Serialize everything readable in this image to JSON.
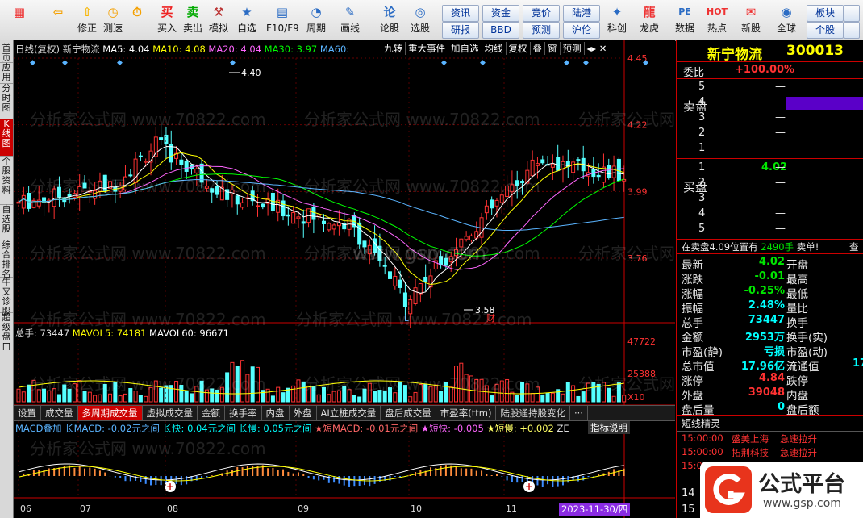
{
  "toolbar": {
    "buttons": [
      {
        "label": "",
        "icon": "grid-icon"
      },
      {
        "label": "",
        "icon": "back-arrow-icon"
      },
      {
        "label": "修正",
        "icon": "arrows-up-down-icon"
      },
      {
        "label": "测速",
        "icon": "speed-icon"
      },
      {
        "label": "",
        "icon": "clock-icon"
      },
      {
        "label": "买入",
        "icon": "buy-icon",
        "glyph": "买"
      },
      {
        "label": "卖出",
        "icon": "sell-icon",
        "glyph": "卖"
      },
      {
        "label": "模拟",
        "icon": "hammer-icon"
      },
      {
        "label": "自选",
        "icon": "folder-star-icon"
      },
      {
        "label": "F10/F9",
        "icon": "f10-icon"
      },
      {
        "label": "周期",
        "icon": "cycle-icon"
      },
      {
        "label": "画线",
        "icon": "pencil-icon"
      },
      {
        "label": "论股",
        "icon": "discuss-icon",
        "glyph": "论"
      },
      {
        "label": "选股",
        "icon": "select-stock-icon"
      },
      {
        "label": "科创",
        "icon": "star-market-icon"
      },
      {
        "label": "龙虎",
        "icon": "dragon-tiger-icon"
      },
      {
        "label": "数据",
        "icon": "pe-data-icon",
        "glyph": "PE"
      },
      {
        "label": "热点",
        "icon": "hot-icon",
        "glyph": "HOT"
      },
      {
        "label": "新股",
        "icon": "new-stock-icon"
      },
      {
        "label": "全球",
        "icon": "globe-icon"
      }
    ],
    "small_buttons": [
      "资讯",
      "资金",
      "竞价",
      "陆港",
      "研报",
      "BBD",
      "预测",
      "沪伦",
      "板块",
      "个股"
    ]
  },
  "left_tabs": [
    "首页",
    "应用",
    "分时图",
    "K线图",
    "个股资料",
    "自选股",
    "综合排名",
    "牛叉诊股",
    "超级盘口"
  ],
  "chart": {
    "stock_name": "新宁物流",
    "indicator_line": {
      "period": "日线(复权)",
      "name": "新宁物流",
      "ma5": "MA5: 4.04",
      "ma10": "MA10: 4.08",
      "ma20": "MA20: 4.04",
      "ma30": "MA30: 3.97",
      "ma60": "MA60: "
    },
    "top_buttons": [
      "九转",
      "重大事件",
      "加自选",
      "均线",
      "复权",
      "叠",
      "窗",
      "预测"
    ],
    "price_axis": [
      "4.45",
      "4.22",
      "3.99",
      "3.76"
    ],
    "high_label": "4.40",
    "low_label": "3.58",
    "marker_L": "L",
    "marker_cai": "财",
    "volume_line": {
      "total": "总手: 73447",
      "mavol5": "MAVOL5: 74181",
      "mavol60": "MAVOL60: 96671"
    },
    "volume_axis": [
      "47722",
      "25388"
    ],
    "volume_unit": "X10",
    "indicator_tabs": [
      "设置",
      "成交量",
      "多周期成交量",
      "虚拟成交量",
      "金额",
      "换手率",
      "内盘",
      "外盘",
      "AI立桩成交量",
      "盘后成交量",
      "市盈率(ttm)",
      "陆股通持股变化",
      "···"
    ],
    "macd_line": {
      "a": "MACD叠加 长MACD: -0.02元之间",
      "b": "长快: 0.04元之间",
      "c": "长慢: 0.05元之间",
      "d": "★短MACD: -0.01元之间",
      "e": "★短快: -0.005",
      "f": "★短慢: +0.002",
      "g": "ZE",
      "help": "指标说明"
    },
    "x_axis": [
      "06",
      "07",
      "08",
      "09",
      "10",
      "11"
    ],
    "date_cursor": "2023-11-30/四",
    "watermarks": [
      "分析家公式网 www.70822.com",
      "www.gsp.com"
    ]
  },
  "right_panel": {
    "title": "新宁物流",
    "code": "300013",
    "weibi_label": "委比",
    "weibi_value": "+100.00%",
    "sell_label": "卖盘",
    "sell_levels": [
      {
        "level": "5",
        "price": "",
        "vol": "—"
      },
      {
        "level": "4",
        "price": "",
        "vol": "—"
      },
      {
        "level": "3",
        "price": "",
        "vol": "—"
      },
      {
        "level": "2",
        "price": "",
        "vol": "—"
      },
      {
        "level": "1",
        "price": "",
        "vol": "—"
      }
    ],
    "buy_label": "买盘",
    "buy_levels": [
      {
        "level": "1",
        "price": "4.02",
        "vol": "—"
      },
      {
        "level": "2",
        "price": "",
        "vol": "—"
      },
      {
        "level": "3",
        "price": "",
        "vol": "—"
      },
      {
        "level": "4",
        "price": "",
        "vol": "—"
      },
      {
        "level": "5",
        "price": "",
        "vol": "—"
      }
    ],
    "notice": "在卖盘4.09位置有",
    "notice_vol": "2490手",
    "notice_act": "卖单!",
    "notice_more": "查",
    "quote_rows": [
      {
        "l": "最新",
        "v": "4.02",
        "vc": "grn",
        "r": "开盘"
      },
      {
        "l": "涨跌",
        "v": "-0.01",
        "vc": "grn",
        "r": "最高"
      },
      {
        "l": "涨幅",
        "v": "-0.25%",
        "vc": "grn",
        "r": "最低"
      },
      {
        "l": "振幅",
        "v": "2.48%",
        "vc": "cyn",
        "r": "量比"
      },
      {
        "l": "总手",
        "v": "73447",
        "vc": "cyn",
        "r": "换手"
      },
      {
        "l": "金额",
        "v": "2953万",
        "vc": "cyn",
        "r": "换手(实)"
      },
      {
        "l": "市盈(静)",
        "v": "亏损",
        "vc": "cyn",
        "r": "市盈(动)"
      },
      {
        "l": "总市值",
        "v": "17.96亿",
        "vc": "cyn",
        "r": "流通值",
        "rv": "17"
      },
      {
        "l": "涨停",
        "v": "4.84",
        "vc": "red",
        "r": "跌停"
      },
      {
        "l": "外盘",
        "v": "39048",
        "vc": "red",
        "r": "内盘"
      },
      {
        "l": "盘后量",
        "v": "0",
        "vc": "cyn",
        "r": "盘后额"
      }
    ],
    "short_title": "短线精灵",
    "short_items": [
      {
        "time": "15:00:00",
        "name": "盛美上海",
        "event": "急速拉升"
      },
      {
        "time": "15:00:00",
        "name": "拓荆科技",
        "event": "急速拉升"
      },
      {
        "time": "15:00:00",
        "name": "神通科技",
        "event": "打开跌停板"
      }
    ],
    "bottom_numbers": [
      "14",
      "15"
    ]
  },
  "corner_logo": {
    "text": "公式平台",
    "url_text": "www.gsp.com"
  },
  "colors": {
    "up": "#ff3232",
    "down": "#54ffff",
    "ma5": "#ffffff",
    "ma10": "#ffff00",
    "ma20": "#ff66ff",
    "ma30": "#00ff00",
    "ma60": "#5ab4ff"
  }
}
